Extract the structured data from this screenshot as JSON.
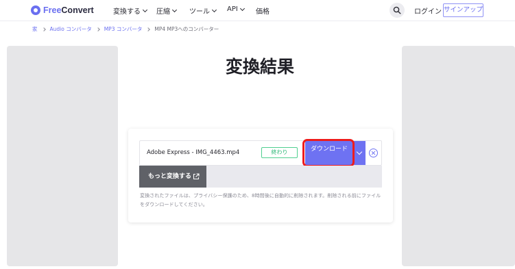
{
  "brand": {
    "name_part1": "Free",
    "name_part2": "Convert",
    "accent": "#6a6ff0"
  },
  "nav": {
    "items": [
      {
        "label": "変換する",
        "has_dropdown": true
      },
      {
        "label": "圧縮",
        "has_dropdown": true
      },
      {
        "label": "ツール",
        "has_dropdown": true
      },
      {
        "label": "API",
        "has_dropdown": true
      },
      {
        "label": "価格",
        "has_dropdown": false
      }
    ],
    "login": "ログイン",
    "signup": "サインアップ",
    "search_icon": "search-icon"
  },
  "breadcrumb": {
    "items": [
      "家",
      "Audio コンバータ",
      "MP3 コンバータ",
      "MP4 MP3へのコンバーター"
    ]
  },
  "page": {
    "title": "変換結果"
  },
  "result": {
    "file_name": "Adobe Express - IMG_4463.mp4",
    "status": "終わり",
    "status_color": "#2fb878",
    "download_label": "ダウンロード",
    "more_convert_label": "もっと変換する",
    "note": "変換されたファイルは、プライバシー保護のため、8時間後に自動的に削除されます。削除される前にファイルをダウンロードしてください。",
    "highlight_color": "#ee1c1c"
  }
}
